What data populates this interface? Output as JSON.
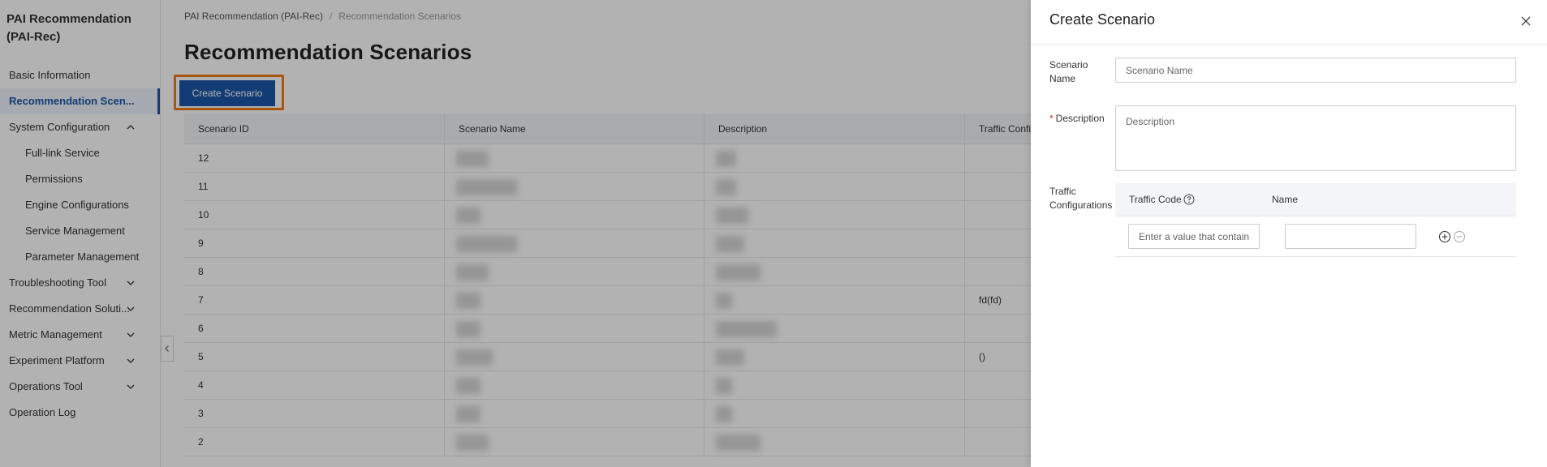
{
  "app": {
    "title": "PAI Recommendation (PAI-Rec)"
  },
  "sidebar": {
    "items": [
      {
        "label": "Basic Information",
        "level": 0,
        "expandable": false,
        "active": false
      },
      {
        "label": "Recommendation Scen...",
        "level": 0,
        "expandable": false,
        "active": true
      },
      {
        "label": "System Configuration",
        "level": 0,
        "expandable": true,
        "expanded": true,
        "active": false
      },
      {
        "label": "Full-link Service",
        "level": 1,
        "expandable": false,
        "active": false
      },
      {
        "label": "Permissions",
        "level": 1,
        "expandable": false,
        "active": false
      },
      {
        "label": "Engine Configurations",
        "level": 1,
        "expandable": false,
        "active": false
      },
      {
        "label": "Service Management",
        "level": 1,
        "expandable": false,
        "active": false
      },
      {
        "label": "Parameter Management",
        "level": 1,
        "expandable": false,
        "active": false
      },
      {
        "label": "Troubleshooting Tool",
        "level": 0,
        "expandable": true,
        "expanded": false,
        "active": false
      },
      {
        "label": "Recommendation Soluti...",
        "level": 0,
        "expandable": true,
        "expanded": false,
        "active": false
      },
      {
        "label": "Metric Management",
        "level": 0,
        "expandable": true,
        "expanded": false,
        "active": false
      },
      {
        "label": "Experiment Platform",
        "level": 0,
        "expandable": true,
        "expanded": false,
        "active": false
      },
      {
        "label": "Operations Tool",
        "level": 0,
        "expandable": true,
        "expanded": false,
        "active": false
      },
      {
        "label": "Operation Log",
        "level": 0,
        "expandable": false,
        "active": false
      }
    ]
  },
  "breadcrumb": [
    "PAI Recommendation (PAI-Rec)",
    "Recommendation Scenarios"
  ],
  "page": {
    "title": "Recommendation Scenarios",
    "create_button": "Create Scenario"
  },
  "table": {
    "columns": [
      "Scenario ID",
      "Scenario Name",
      "Description",
      "Traffic Confi"
    ],
    "rows": [
      {
        "id": "12",
        "traffic": ""
      },
      {
        "id": "11",
        "traffic": ""
      },
      {
        "id": "10",
        "traffic": ""
      },
      {
        "id": "9",
        "traffic": ""
      },
      {
        "id": "8",
        "traffic": ""
      },
      {
        "id": "7",
        "traffic": "fd(fd)"
      },
      {
        "id": "6",
        "traffic": ""
      },
      {
        "id": "5",
        "traffic": "()"
      },
      {
        "id": "4",
        "traffic": ""
      },
      {
        "id": "3",
        "traffic": ""
      },
      {
        "id": "2",
        "traffic": ""
      }
    ]
  },
  "drawer": {
    "title": "Create Scenario",
    "name_label": "Scenario Name",
    "name_placeholder": "Scenario Name",
    "name_value": "",
    "description_label": "Description",
    "description_required": "*",
    "description_placeholder": "Description",
    "description_value": "",
    "traffic_label": "Traffic Configurations",
    "traffic_columns": [
      "Traffic Code",
      "Name"
    ],
    "traffic_rows": [
      {
        "code_placeholder": "Enter a value that contain",
        "code_value": "",
        "name_value": ""
      }
    ]
  },
  "colors": {
    "primary": "#1a57a8",
    "highlight": "#f07a16",
    "required": "#d93026"
  }
}
